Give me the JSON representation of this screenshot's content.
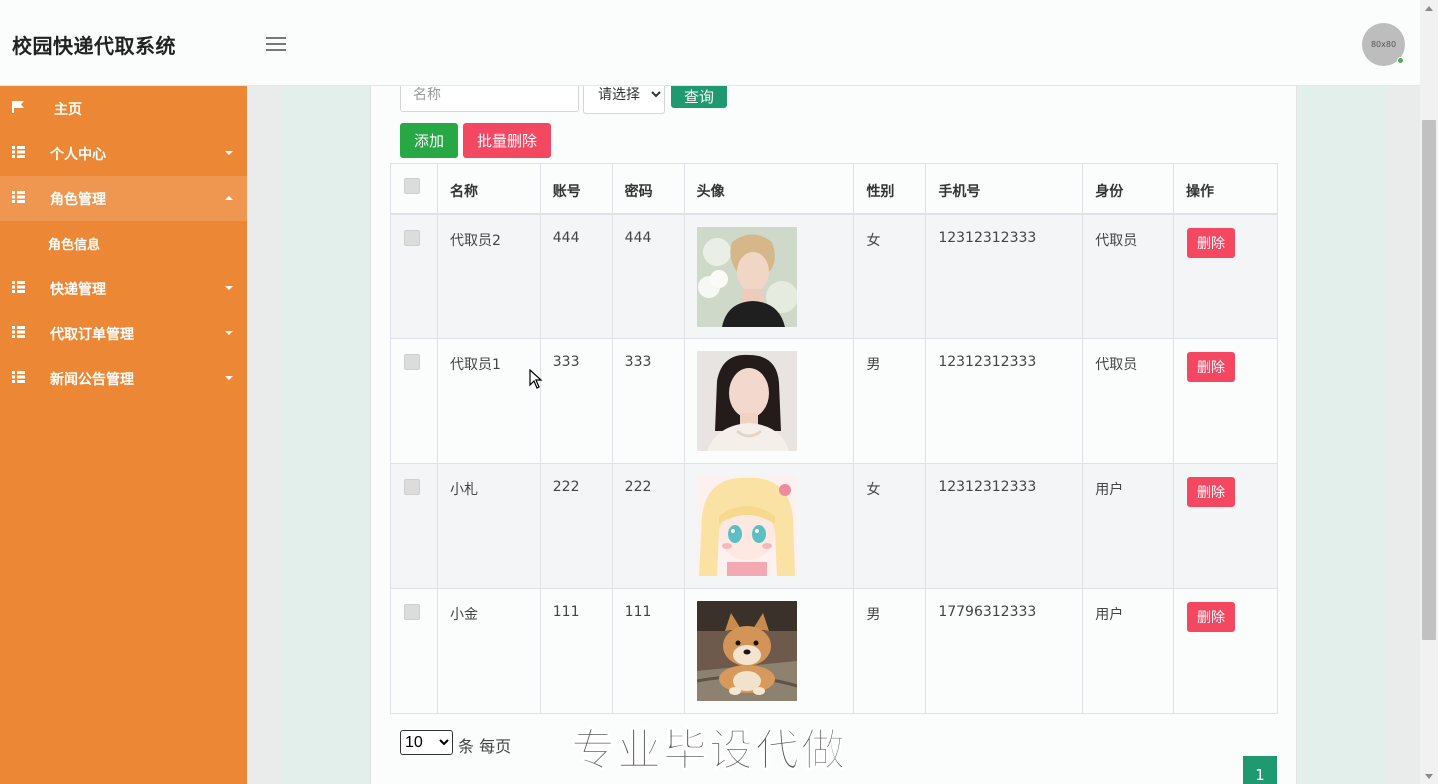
{
  "app": {
    "title": "校园快递代取系统",
    "avatar_text": "80x80"
  },
  "sidebar": {
    "items": [
      {
        "label": "主页",
        "icon": "flag-icon",
        "has_caret": false
      },
      {
        "label": "个人中心",
        "icon": "grid-icon",
        "has_caret": true
      },
      {
        "label": "角色管理",
        "icon": "grid-icon",
        "has_caret": true,
        "expanded": true
      },
      {
        "label": "快递管理",
        "icon": "grid-icon",
        "has_caret": true
      },
      {
        "label": "代取订单管理",
        "icon": "grid-icon",
        "has_caret": true
      },
      {
        "label": "新闻公告管理",
        "icon": "grid-icon",
        "has_caret": true
      }
    ],
    "sub_item": "角色信息"
  },
  "search": {
    "placeholder": "名称",
    "select_value": "请选择",
    "query_label": "查询"
  },
  "toolbar": {
    "add_label": "添加",
    "batch_delete_label": "批量删除"
  },
  "table": {
    "headers": [
      "名称",
      "账号",
      "密码",
      "头像",
      "性别",
      "手机号",
      "身份",
      "操作"
    ],
    "rows": [
      {
        "name": "代取员2",
        "account": "444",
        "password": "444",
        "avatar": "photo-young-man-flowers",
        "gender": "女",
        "phone": "12312312333",
        "role": "代取员",
        "action": "删除"
      },
      {
        "name": "代取员1",
        "account": "333",
        "password": "333",
        "avatar": "photo-woman-portrait",
        "gender": "男",
        "phone": "12312312333",
        "role": "代取员",
        "action": "删除"
      },
      {
        "name": "小札",
        "account": "222",
        "password": "222",
        "avatar": "anime-girl",
        "gender": "女",
        "phone": "12312312333",
        "role": "用户",
        "action": "删除"
      },
      {
        "name": "小金",
        "account": "111",
        "password": "111",
        "avatar": "shiba-dog",
        "gender": "男",
        "phone": "17796312333",
        "role": "用户",
        "action": "删除"
      }
    ]
  },
  "pagination": {
    "per_page": "10",
    "per_page_label": "条 每页",
    "current_page": "1"
  },
  "watermark": "专业毕设代做",
  "colors": {
    "sidebar": "#ec8736",
    "primary": "#1f9a70",
    "success": "#28a745",
    "danger": "#f34762"
  }
}
